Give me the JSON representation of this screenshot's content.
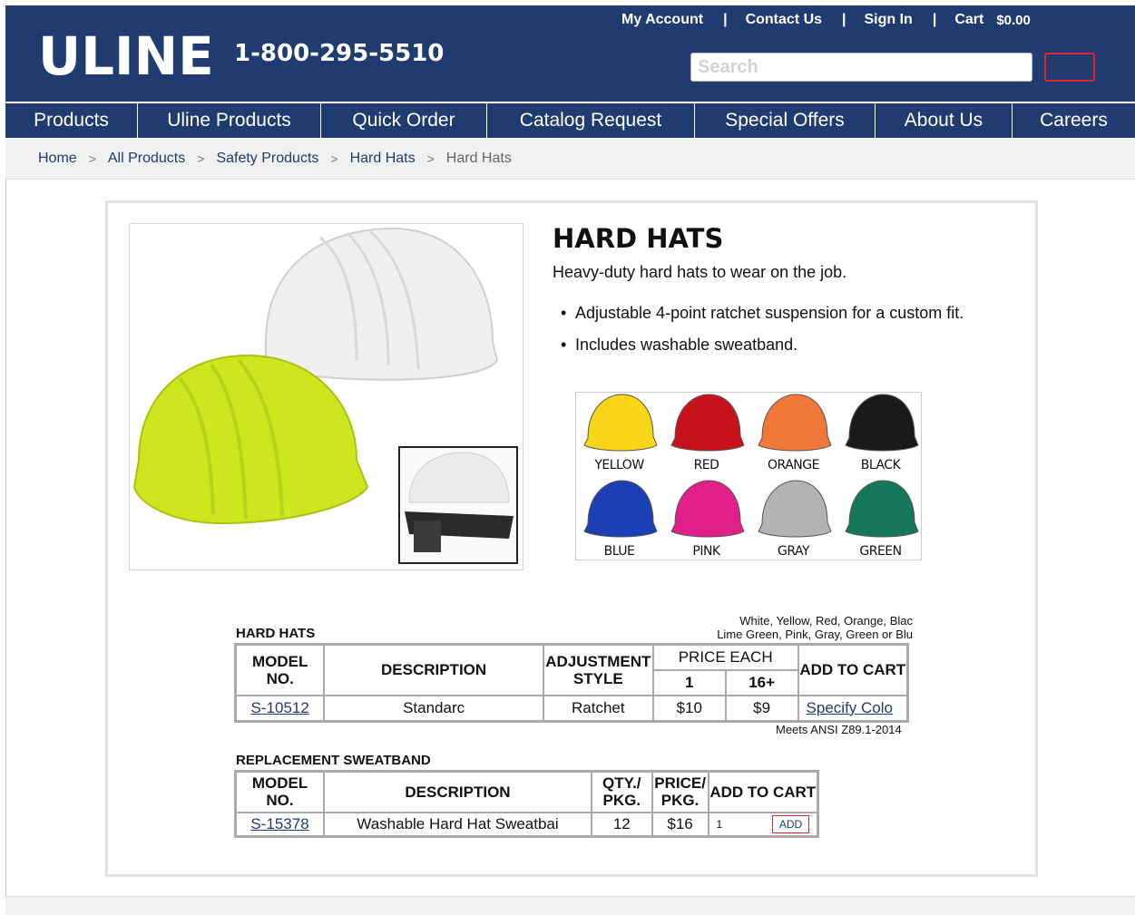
{
  "header": {
    "logo": "ULINE",
    "phone": "1-800-295-5510",
    "links": {
      "account": "My Account",
      "contact": "Contact Us",
      "signin": "Sign In",
      "cart": "Cart",
      "cart_amount": "$0.00",
      "separator": "|"
    },
    "search_placeholder": "Search"
  },
  "nav": [
    "Products",
    "Uline Products",
    "Quick Order",
    "Catalog Request",
    "Special Offers",
    "About Us",
    "Careers"
  ],
  "breadcrumb": {
    "items": [
      "Home",
      "All Products",
      "Safety Products",
      "Hard Hats"
    ],
    "current": "Hard Hats",
    "separator": ">"
  },
  "product": {
    "title": "HARD HATS",
    "subtitle": "Heavy-duty hard hats to wear on the job.",
    "bullets": [
      "Adjustable 4-point ratchet suspension for a custom fit.",
      "Includes washable sweatband."
    ],
    "colors": [
      {
        "label": "YELLOW",
        "hex": "#f7d617"
      },
      {
        "label": "RED",
        "hex": "#c8121b"
      },
      {
        "label": "ORANGE",
        "hex": "#f2783a"
      },
      {
        "label": "BLACK",
        "hex": "#1a1a1a"
      },
      {
        "label": "BLUE",
        "hex": "#1d3fb4"
      },
      {
        "label": "PINK",
        "hex": "#e0208a"
      },
      {
        "label": "GRAY",
        "hex": "#b3b3b3"
      },
      {
        "label": "GREEN",
        "hex": "#16765a"
      }
    ]
  },
  "hard_hats_table": {
    "caption": "HARD HATS",
    "note_line1": "White, Yellow, Red, Orange, Blac",
    "note_line2": "Lime Green, Pink, Gray, Green or Blu",
    "headers": {
      "model": "MODEL NO.",
      "description": "DESCRIPTION",
      "adjustment": "ADJUSTMENT STYLE",
      "price_each": "PRICE EACH",
      "qty1": "1",
      "qty16": "16+",
      "add": "ADD TO CART"
    },
    "row": {
      "model": "S-10512",
      "description": "Standarc",
      "adjustment": "Ratchet",
      "price1": "$10",
      "price16": "$9",
      "action": "Specify Colo"
    },
    "footnote": "Meets ANSI Z89.1-2014"
  },
  "sweatband_table": {
    "caption": "REPLACEMENT SWEATBAND",
    "headers": {
      "model": "MODEL NO.",
      "description": "DESCRIPTION",
      "qty": "QTY./ PKG.",
      "price": "PRICE/ PKG.",
      "add": "ADD TO CART"
    },
    "row": {
      "model": "S-15378",
      "description": "Washable Hard Hat Sweatbai",
      "qty": "12",
      "price": "$16",
      "qty_value": "1",
      "add_label": "ADD"
    }
  }
}
